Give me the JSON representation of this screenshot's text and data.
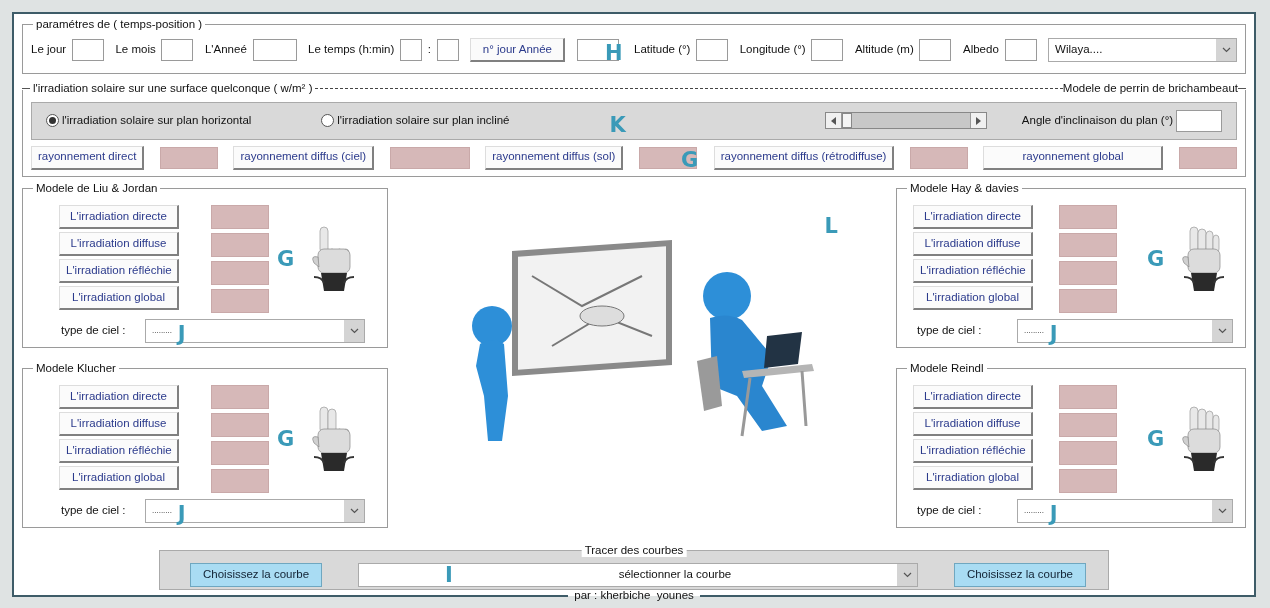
{
  "params": {
    "legend": "paramétres de ( temps-position )",
    "items": [
      {
        "kind": "field",
        "label": "Le jour"
      },
      {
        "kind": "field",
        "label": "Le mois"
      },
      {
        "kind": "wide-field",
        "label": "L'Anneé"
      },
      {
        "kind": "time",
        "label": "Le temps (h:min)",
        "separator": ":"
      },
      {
        "kind": "button",
        "label": "n° jour Année"
      },
      {
        "kind": "bare-field",
        "annotation": "H"
      },
      {
        "kind": "field",
        "label": "Latitude (°)"
      },
      {
        "kind": "field",
        "label": "Longitude (°)"
      },
      {
        "kind": "field",
        "label": "Altitude (m)"
      },
      {
        "kind": "field",
        "label": "Albedo"
      },
      {
        "kind": "select",
        "value": "Wilaya...."
      }
    ]
  },
  "irradiation": {
    "legend": "l'irradiation solaire sur une surface quelconque ( w/m² )",
    "legend_right": "Modele de perrin de brichambeaut",
    "options": [
      {
        "label": "l'irradiation solaire sur plan horizontal",
        "selected": true
      },
      {
        "label": "l'irradiation solaire sur plan incliné",
        "selected": false
      }
    ],
    "annotation": "K",
    "angle_label": "Angle d'inclinaison du plan (°)",
    "outputs": [
      {
        "label": "rayonnement direct"
      },
      {
        "label": "rayonnement diffus (ciel)"
      },
      {
        "label": "rayonnement diffus (sol)",
        "annotation": "G"
      },
      {
        "label": "rayonnement diffus (rétrodiffuse)"
      },
      {
        "label": "rayonnement global"
      }
    ]
  },
  "left_models": [
    {
      "title": "Modele de Liu & Jordan",
      "buttons": [
        "L'irradiation directe",
        "L'irradiation diffuse",
        "L'irradiation réfléchie",
        "L'irradiation global"
      ],
      "annotation": "G",
      "kind": "one-finger",
      "sky_label": "type de ciel :",
      "sky_value": ".........",
      "sky_annotation": "J"
    },
    {
      "title": "Modele Klucher",
      "buttons": [
        "L'irradiation directe",
        "L'irradiation diffuse",
        "L'irradiation réfléchie",
        "L'irradiation global"
      ],
      "annotation": "G",
      "kind": "two-finger",
      "sky_label": "type de ciel :",
      "sky_value": ".........",
      "sky_annotation": "J"
    }
  ],
  "center": {
    "kind": "picture",
    "annotation": "L"
  },
  "right_models": [
    {
      "title": "Modele Hay & davies",
      "buttons": [
        "L'irradiation directe",
        "L'irradiation diffuse",
        "L'irradiation réfléchie",
        "L'irradiation global"
      ],
      "annotation": "G",
      "kind": "four-finger",
      "sky_label": "type de ciel :",
      "sky_value": ".........",
      "sky_annotation": "J"
    },
    {
      "title": "Modele Reindl",
      "buttons": [
        "L'irradiation directe",
        "L'irradiation diffuse",
        "L'irradiation réfléchie",
        "L'irradiation global"
      ],
      "annotation": "G",
      "kind": "four-finger",
      "sky_label": "type de ciel :",
      "sky_value": ".........",
      "sky_annotation": "J"
    }
  ],
  "curves": {
    "legend": "Tracer des courbes",
    "buttons": [
      "Choisissez la courbe",
      "Choisissez la courbe"
    ],
    "select": {
      "value": "sélectionner la courbe",
      "annotation": "I"
    }
  },
  "footer": "par : kherbiche  younes"
}
